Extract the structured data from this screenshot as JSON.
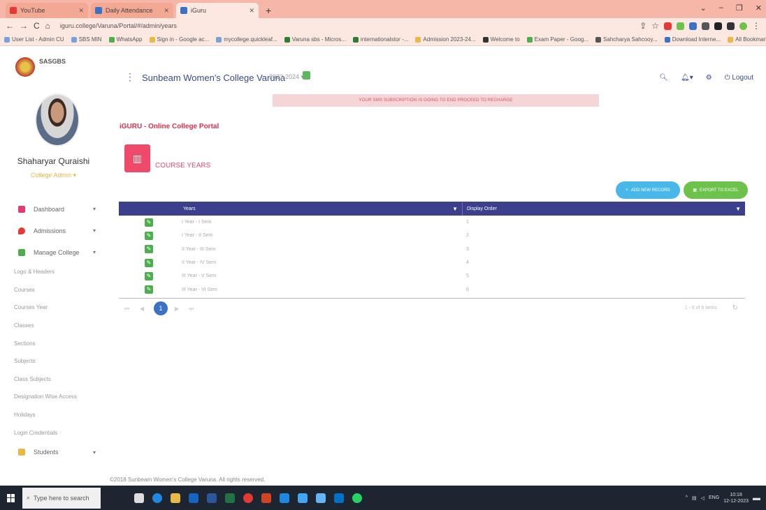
{
  "browser": {
    "tabs": [
      {
        "title": "YouTube",
        "color": "#e53935"
      },
      {
        "title": "Daily Attendance",
        "color": "#3b72c4"
      },
      {
        "title": "iGuru",
        "color": "#3b72c4"
      }
    ],
    "new_tab": "+",
    "url": "iguru.college/Varuna/Portal/#/admin/years",
    "bookmarks": [
      "User List - Admin CU",
      "SBS MIN",
      "WhatsApp",
      "Sign in - Google ac...",
      "mycollege.quickleaf...",
      "Varuna sbs - Micros...",
      "internationalstor -...",
      "Admission 2023-24...",
      "Welcome to",
      "Exam Paper - Goog...",
      "Sahcharya Sahcooy...",
      "Download Interne...",
      "All Bookmarks"
    ]
  },
  "sidebar": {
    "brand": "SASGBS",
    "user_name": "Shaharyar Quraishi",
    "user_role": "College Admin",
    "menu": [
      {
        "label": "Dashboard",
        "icon": "dashboard-icon",
        "color": "#e53970"
      },
      {
        "label": "Admissions",
        "icon": "admissions-icon",
        "color": "#e53935"
      },
      {
        "label": "Manage College",
        "icon": "manage-college-icon",
        "color": "#4cae4c"
      }
    ],
    "submenu": [
      "Logo & Headers",
      "Courses",
      "Courses Year",
      "Classes",
      "Sections",
      "Subjects",
      "Class Subjects",
      "Designation Wise Access",
      "Holidays",
      "Login Credentials"
    ],
    "students": {
      "label": "Students",
      "icon": "students-icon",
      "color": "#e8b947"
    }
  },
  "header": {
    "college": "Sunbeam Women's College Varuna",
    "year": "2023-2024",
    "logout": "Logout"
  },
  "banner": "YOUR SMS SUBSCRIPTION IS GOING TO END PROCEED TO RECHARGE",
  "page": {
    "portal_title": "iGURU - Online College Portal",
    "section_title": "COURSE YEARS",
    "add_button": "ADD NEW RECORD",
    "export_button": "EXPORT TO EXCEL"
  },
  "table": {
    "columns": [
      "Years",
      "Display Order"
    ],
    "rows": [
      {
        "year": "I Year - I Sem",
        "order": "1"
      },
      {
        "year": "I Year - II Sem",
        "order": "2"
      },
      {
        "year": "II Year - III Sem",
        "order": "3"
      },
      {
        "year": "II Year - IV Sem",
        "order": "4"
      },
      {
        "year": "III Year - V Sem",
        "order": "5"
      },
      {
        "year": "III Year - VI Sem",
        "order": "6"
      }
    ],
    "current_page": "1",
    "page_info": "1 - 6 of 6 items"
  },
  "footer": "©2018 Sunbeam Women's College Varuna. All rights reserved.",
  "taskbar": {
    "search_placeholder": "Type here to search",
    "lang": "ENG",
    "time": "10:18",
    "date": "12-12-2023"
  }
}
